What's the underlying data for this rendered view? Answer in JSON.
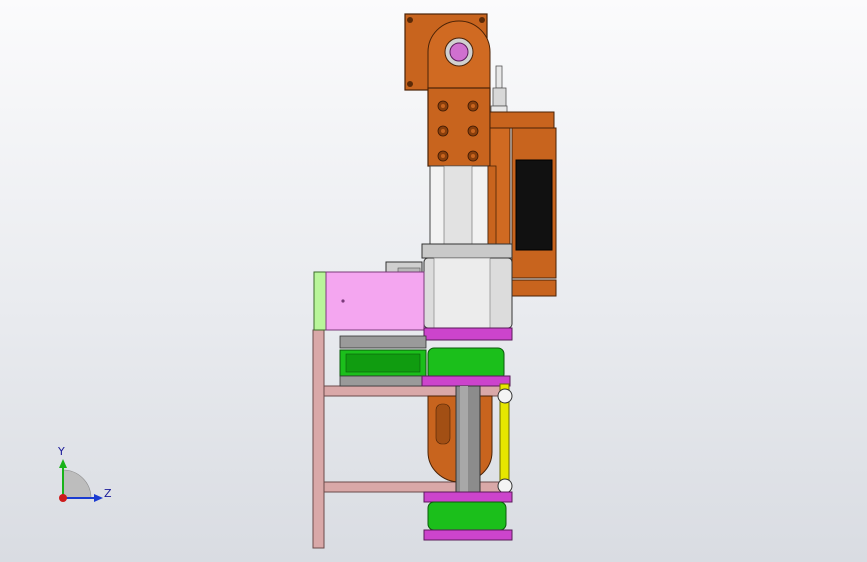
{
  "viewport": {
    "background_top": "#fbfbfc",
    "background_bottom": "#d9dce2"
  },
  "colors": {
    "orange": "#c8641e",
    "orange_dark": "#8a3f0c",
    "pink": "#f4a6f0",
    "magenta": "#cc44cc",
    "green": "#1bbf1b",
    "green_dark": "#0f7a0f",
    "lime": "#b9f59a",
    "gray": "#d4d4d4",
    "gray_dark": "#8c8c8c",
    "frame": "#d7a8a8",
    "yellow": "#e6e600",
    "black": "#111111"
  },
  "triad": {
    "y_label": "Y",
    "z_label": "Z",
    "y_color": "#19b319",
    "z_color": "#1a3bd1",
    "x_color": "#cc1a1a"
  }
}
